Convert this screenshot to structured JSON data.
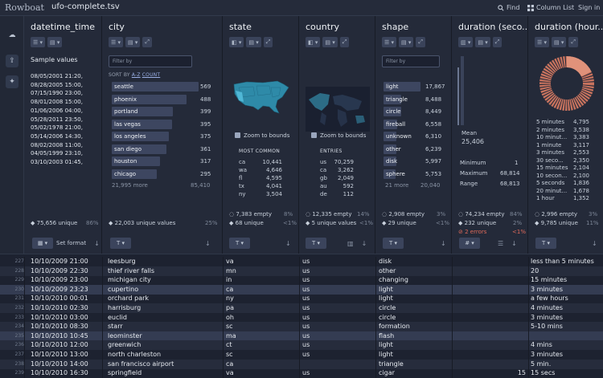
{
  "app": {
    "logo": "Rowboat",
    "file_name": "ufo-complete.tsv"
  },
  "toolbar": {
    "find": "Find",
    "column_list": "Column List",
    "sign_in": "Sign in"
  },
  "filter_placeholder": "Filter by",
  "sort_by": {
    "prefix": "SORT BY ",
    "az": "A-Z",
    "count": "COUNT"
  },
  "columns": {
    "datetime": {
      "name": "datetime_time",
      "sample_title": "Sample values",
      "samples": [
        "08/05/2001 21:20,",
        "08/28/2005 15:00,",
        "07/15/1990 23:00,",
        "08/01/2008 15:00,",
        "01/06/2006 04:00,",
        "05/28/2011 23:50,",
        "05/02/1978 21:00,",
        "05/14/2006 14:30,",
        "08/02/2008 11:00,",
        "04/05/1999 23:10,",
        "03/10/2003 01:45,"
      ],
      "unique": "75,656 unique",
      "unique_pct": "86%",
      "set_format": "Set format"
    },
    "city": {
      "name": "city",
      "items": [
        {
          "label": "seattle",
          "count": "569",
          "frac": 1.0
        },
        {
          "label": "phoenix",
          "count": "488",
          "frac": 0.86
        },
        {
          "label": "portland",
          "count": "399",
          "frac": 0.7
        },
        {
          "label": "las vegas",
          "count": "395",
          "frac": 0.69
        },
        {
          "label": "los angeles",
          "count": "375",
          "frac": 0.66
        },
        {
          "label": "san diego",
          "count": "361",
          "frac": 0.63
        },
        {
          "label": "houston",
          "count": "317",
          "frac": 0.56
        },
        {
          "label": "chicago",
          "count": "295",
          "frac": 0.52
        }
      ],
      "more": "21,995 more",
      "more_count": "85,410",
      "unique": "22,003 unique values",
      "unique_pct": "25%"
    },
    "state": {
      "name": "state",
      "zoom": "Zoom to bounds",
      "most_common": "MOST COMMON",
      "entries": [
        {
          "k": "ca",
          "v": "10,441"
        },
        {
          "k": "wa",
          "v": "4,646"
        },
        {
          "k": "fl",
          "v": "4,595"
        },
        {
          "k": "tx",
          "v": "4,041"
        },
        {
          "k": "ny",
          "v": "3,504"
        }
      ],
      "empty": "7,383 empty",
      "empty_pct": "8%",
      "unique": "68 unique",
      "unique_pct": "<1%"
    },
    "country": {
      "name": "country",
      "zoom": "Zoom to bounds",
      "entries_title": "ENTRIES",
      "entries": [
        {
          "k": "us",
          "v": "70,259"
        },
        {
          "k": "ca",
          "v": "3,262"
        },
        {
          "k": "gb",
          "v": "2,049"
        },
        {
          "k": "au",
          "v": "592"
        },
        {
          "k": "de",
          "v": "112"
        }
      ],
      "empty": "12,335 empty",
      "empty_pct": "14%",
      "unique": "5 unique values",
      "unique_pct": "<1%"
    },
    "shape": {
      "name": "shape",
      "items": [
        {
          "label": "light",
          "count": "17,867",
          "frac": 1.0
        },
        {
          "label": "triangle",
          "count": "8,488",
          "frac": 0.48
        },
        {
          "label": "circle",
          "count": "8,449",
          "frac": 0.47
        },
        {
          "label": "fireball",
          "count": "6,558",
          "frac": 0.37
        },
        {
          "label": "unknown",
          "count": "6,310",
          "frac": 0.35
        },
        {
          "label": "other",
          "count": "6,239",
          "frac": 0.35
        },
        {
          "label": "disk",
          "count": "5,997",
          "frac": 0.34
        },
        {
          "label": "sphere",
          "count": "5,753",
          "frac": 0.32
        }
      ],
      "more": "21 more",
      "more_count": "20,040",
      "empty": "2,908 empty",
      "empty_pct": "3%",
      "unique": "29 unique",
      "unique_pct": "<1%"
    },
    "duration_sec": {
      "name": "duration (seco...",
      "mean_label": "Mean",
      "mean": "25,406",
      "minimum_label": "Minimum",
      "minimum": "1",
      "maximum_label": "Maximum",
      "maximum": "68,814",
      "range_label": "Range",
      "range": "68,813",
      "empty": "74,234 empty",
      "empty_pct": "84%",
      "unique": "232 unique",
      "unique_pct": "2%",
      "errors": "2 errors",
      "errors_pct": "<1%"
    },
    "duration_hr": {
      "name": "duration (hour...",
      "items": [
        {
          "k": "5 minutes",
          "v": "4,795"
        },
        {
          "k": "2 minutes",
          "v": "3,538"
        },
        {
          "k": "10 minut...",
          "v": "3,383"
        },
        {
          "k": "1 minute",
          "v": "3,117"
        },
        {
          "k": "3 minutes",
          "v": "2,553"
        },
        {
          "k": "30 seco...",
          "v": "2,350"
        },
        {
          "k": "15 minutes",
          "v": "2,104"
        },
        {
          "k": "10 secon...",
          "v": "2,100"
        },
        {
          "k": "5 seconds",
          "v": "1,836"
        },
        {
          "k": "20 minut...",
          "v": "1,678"
        },
        {
          "k": "1 hour",
          "v": "1,352"
        }
      ],
      "empty": "2,996 empty",
      "empty_pct": "3%",
      "unique": "9,785 unique",
      "unique_pct": "11%"
    }
  },
  "rows": [
    {
      "n": "227",
      "dt": "10/10/2009 21:00",
      "city": "leesburg",
      "state": "va",
      "country": "us",
      "shape": "disk",
      "dsec": "",
      "dhr": "less than 5 minutes"
    },
    {
      "n": "228",
      "dt": "10/10/2009 22:30",
      "city": "thief river falls",
      "state": "mn",
      "country": "us",
      "shape": "other",
      "dsec": "",
      "dhr": "20"
    },
    {
      "n": "229",
      "dt": "10/10/2009 23:00",
      "city": "michigan city",
      "state": "in",
      "country": "us",
      "shape": "changing",
      "dsec": "",
      "dhr": "15 minutes"
    },
    {
      "n": "230",
      "dt": "10/10/2009 23:23",
      "city": "cupertino",
      "state": "ca",
      "country": "us",
      "shape": "light",
      "dsec": "",
      "dhr": "3 minutes"
    },
    {
      "n": "231",
      "dt": "10/10/2010 00:01",
      "city": "orchard park",
      "state": "ny",
      "country": "us",
      "shape": "light",
      "dsec": "",
      "dhr": "a few hours"
    },
    {
      "n": "232",
      "dt": "10/10/2010 02:30",
      "city": "harrisburg",
      "state": "pa",
      "country": "us",
      "shape": "circle",
      "dsec": "",
      "dhr": "4  minutes"
    },
    {
      "n": "233",
      "dt": "10/10/2010 03:00",
      "city": "euclid",
      "state": "oh",
      "country": "us",
      "shape": "circle",
      "dsec": "",
      "dhr": "3 minutes"
    },
    {
      "n": "234",
      "dt": "10/10/2010 08:30",
      "city": "starr",
      "state": "sc",
      "country": "us",
      "shape": "formation",
      "dsec": "",
      "dhr": "5-10 mins"
    },
    {
      "n": "235",
      "dt": "10/10/2010 10:45",
      "city": "leominster",
      "state": "ma",
      "country": "us",
      "shape": "flash",
      "dsec": "",
      "dhr": ""
    },
    {
      "n": "236",
      "dt": "10/10/2010 12:00",
      "city": "greenwich",
      "state": "ct",
      "country": "us",
      "shape": "light",
      "dsec": "",
      "dhr": "4 mins"
    },
    {
      "n": "237",
      "dt": "10/10/2010 13:00",
      "city": "north charleston",
      "state": "sc",
      "country": "us",
      "shape": "light",
      "dsec": "",
      "dhr": "3 minutes"
    },
    {
      "n": "238",
      "dt": "10/10/2010 14:00",
      "city": "san francisco airport",
      "state": "ca",
      "country": "",
      "shape": "triangle",
      "dsec": "",
      "dhr": "5 min."
    },
    {
      "n": "239",
      "dt": "10/10/2010 16:30",
      "city": "springfield",
      "state": "va",
      "country": "us",
      "shape": "cigar",
      "dsec": "15",
      "dhr": "15 secs"
    }
  ]
}
